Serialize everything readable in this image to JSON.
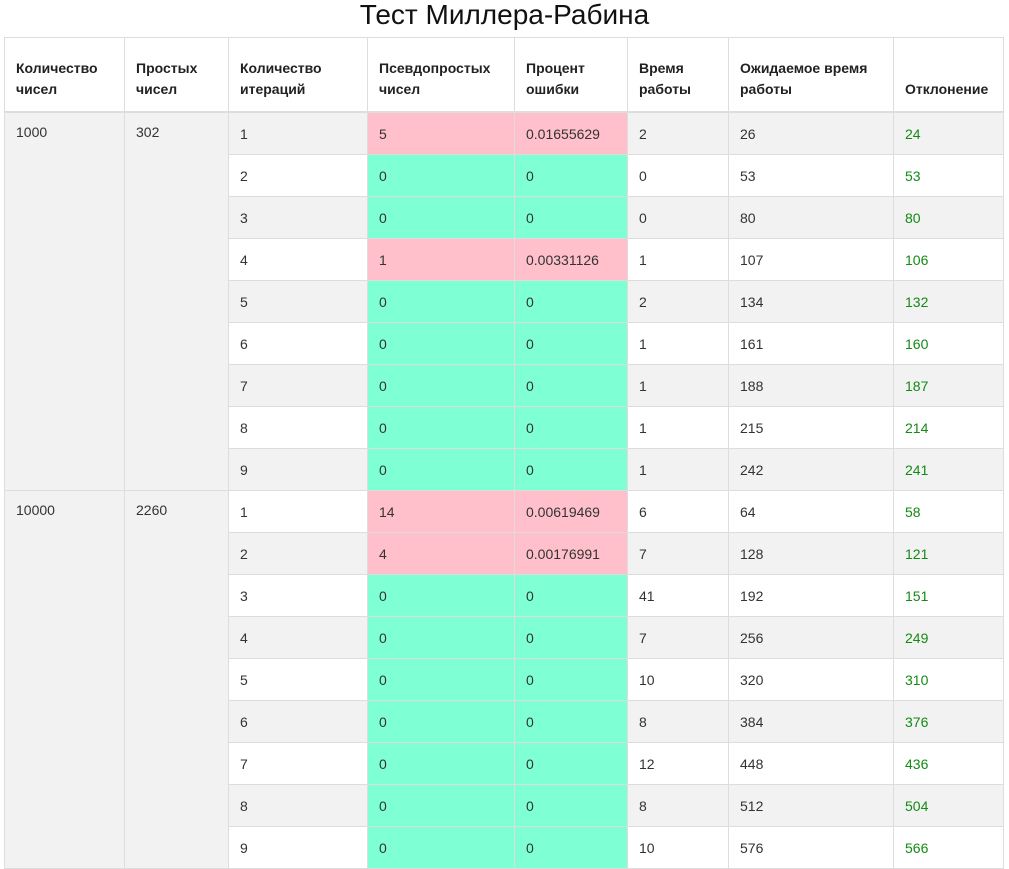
{
  "page": {
    "title": "Тест Миллера-Рабина"
  },
  "table": {
    "headers": [
      "Количество чисел",
      "Простых чисел",
      "Количество итераций",
      "Псевдопростых чисел",
      "Процент ошибки",
      "Время работы",
      "Ожидаемое время работы",
      "Отклонение"
    ],
    "colors": {
      "error": "#ffc0cb",
      "ok": "#7fffd4",
      "deviation_text": "#148a14",
      "zebra": "#f2f2f2"
    },
    "groups": [
      {
        "count": "1000",
        "primes": "302",
        "rows": [
          {
            "iterations": "1",
            "pseudoprimes": "5",
            "error_percent": "0.01655629",
            "time": "2",
            "expected_time": "26",
            "deviation": "24"
          },
          {
            "iterations": "2",
            "pseudoprimes": "0",
            "error_percent": "0",
            "time": "0",
            "expected_time": "53",
            "deviation": "53"
          },
          {
            "iterations": "3",
            "pseudoprimes": "0",
            "error_percent": "0",
            "time": "0",
            "expected_time": "80",
            "deviation": "80"
          },
          {
            "iterations": "4",
            "pseudoprimes": "1",
            "error_percent": "0.00331126",
            "time": "1",
            "expected_time": "107",
            "deviation": "106"
          },
          {
            "iterations": "5",
            "pseudoprimes": "0",
            "error_percent": "0",
            "time": "2",
            "expected_time": "134",
            "deviation": "132"
          },
          {
            "iterations": "6",
            "pseudoprimes": "0",
            "error_percent": "0",
            "time": "1",
            "expected_time": "161",
            "deviation": "160"
          },
          {
            "iterations": "7",
            "pseudoprimes": "0",
            "error_percent": "0",
            "time": "1",
            "expected_time": "188",
            "deviation": "187"
          },
          {
            "iterations": "8",
            "pseudoprimes": "0",
            "error_percent": "0",
            "time": "1",
            "expected_time": "215",
            "deviation": "214"
          },
          {
            "iterations": "9",
            "pseudoprimes": "0",
            "error_percent": "0",
            "time": "1",
            "expected_time": "242",
            "deviation": "241"
          }
        ]
      },
      {
        "count": "10000",
        "primes": "2260",
        "rows": [
          {
            "iterations": "1",
            "pseudoprimes": "14",
            "error_percent": "0.00619469",
            "time": "6",
            "expected_time": "64",
            "deviation": "58"
          },
          {
            "iterations": "2",
            "pseudoprimes": "4",
            "error_percent": "0.00176991",
            "time": "7",
            "expected_time": "128",
            "deviation": "121"
          },
          {
            "iterations": "3",
            "pseudoprimes": "0",
            "error_percent": "0",
            "time": "41",
            "expected_time": "192",
            "deviation": "151"
          },
          {
            "iterations": "4",
            "pseudoprimes": "0",
            "error_percent": "0",
            "time": "7",
            "expected_time": "256",
            "deviation": "249"
          },
          {
            "iterations": "5",
            "pseudoprimes": "0",
            "error_percent": "0",
            "time": "10",
            "expected_time": "320",
            "deviation": "310"
          },
          {
            "iterations": "6",
            "pseudoprimes": "0",
            "error_percent": "0",
            "time": "8",
            "expected_time": "384",
            "deviation": "376"
          },
          {
            "iterations": "7",
            "pseudoprimes": "0",
            "error_percent": "0",
            "time": "12",
            "expected_time": "448",
            "deviation": "436"
          },
          {
            "iterations": "8",
            "pseudoprimes": "0",
            "error_percent": "0",
            "time": "8",
            "expected_time": "512",
            "deviation": "504"
          },
          {
            "iterations": "9",
            "pseudoprimes": "0",
            "error_percent": "0",
            "time": "10",
            "expected_time": "576",
            "deviation": "566"
          }
        ]
      }
    ]
  }
}
